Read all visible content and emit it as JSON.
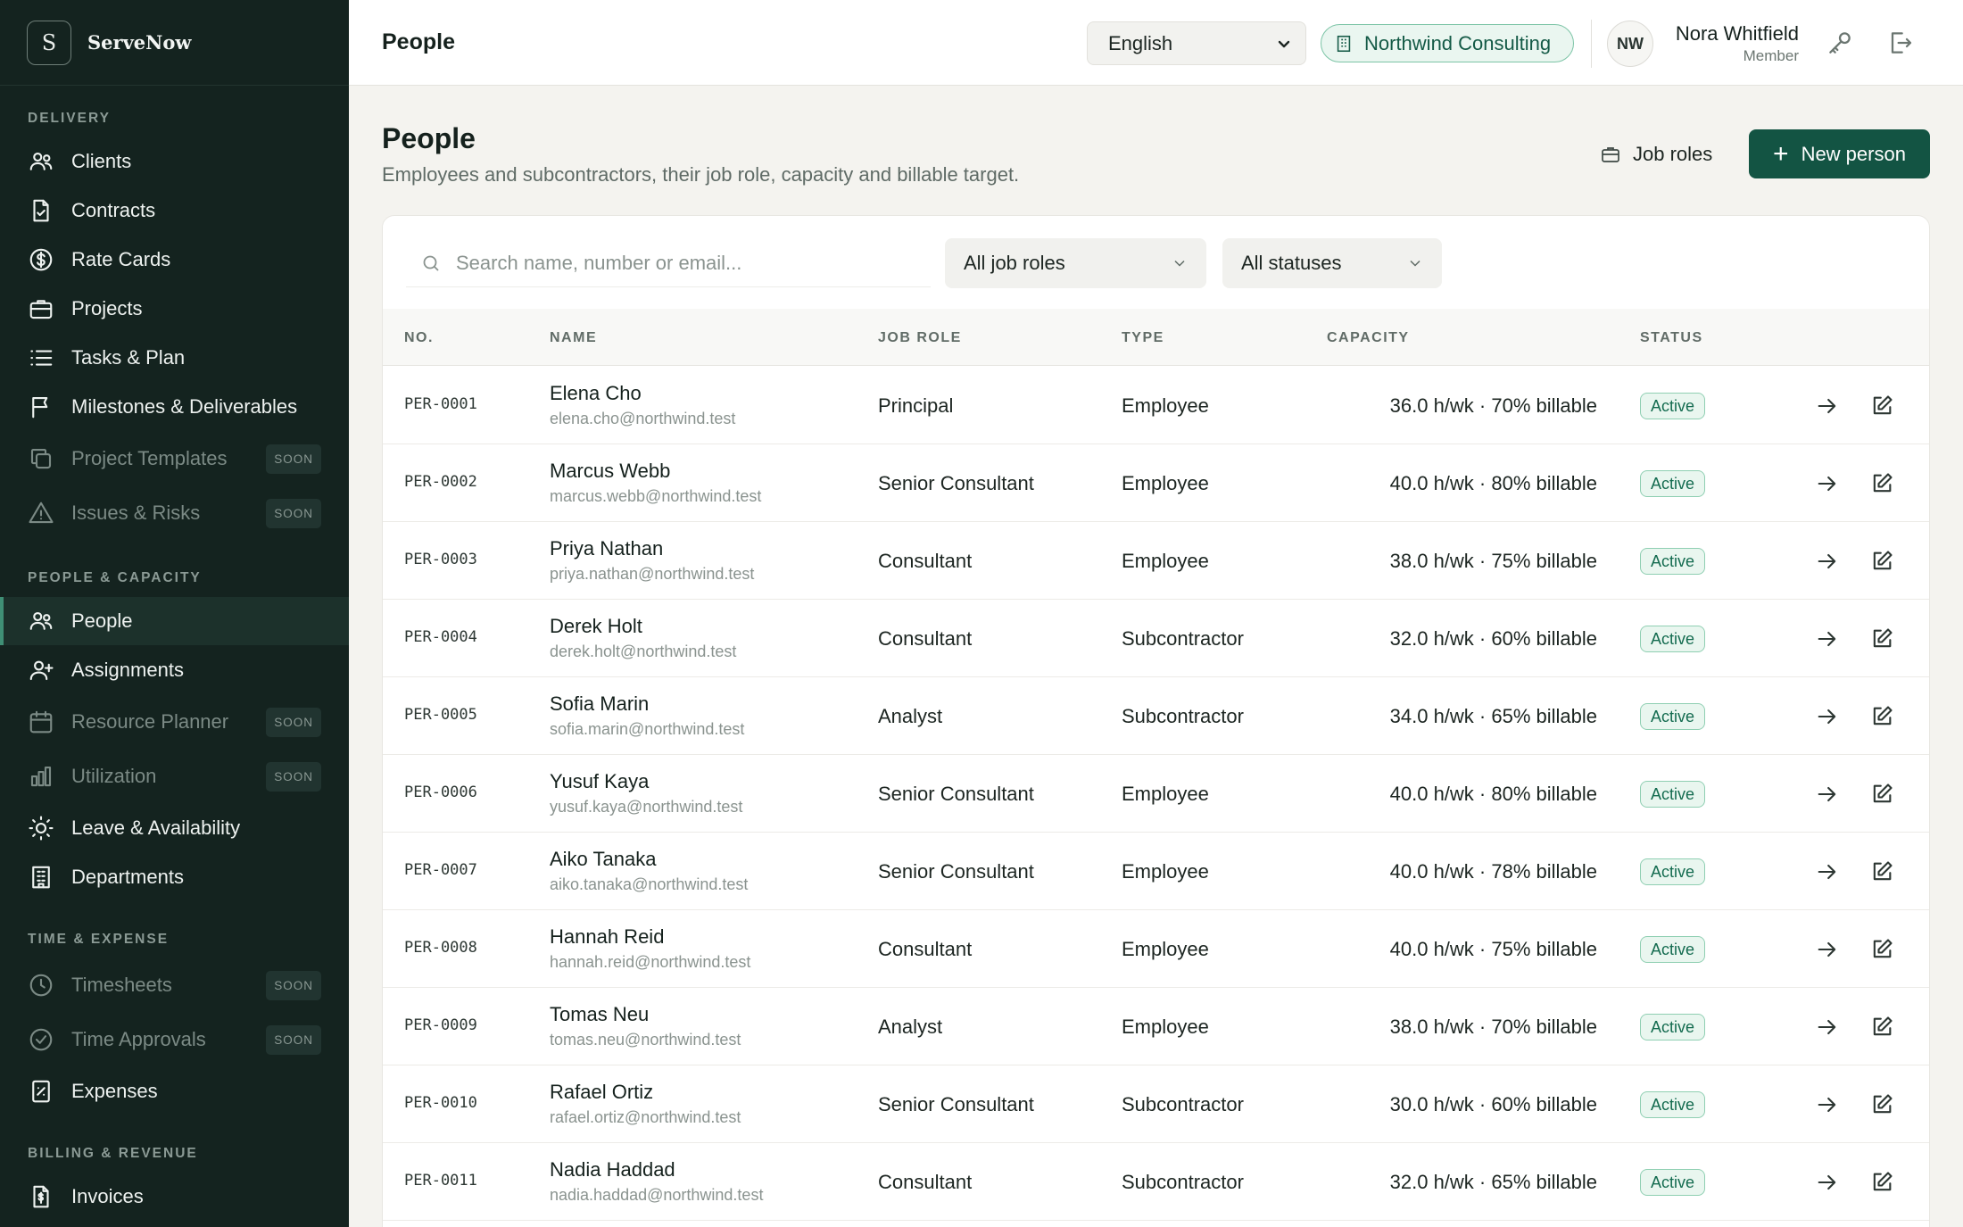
{
  "brand": {
    "logo_letter": "S",
    "name": "ServeNow"
  },
  "sidebar": {
    "sections": [
      {
        "label": "DELIVERY"
      },
      {
        "label": "PEOPLE & CAPACITY"
      },
      {
        "label": "TIME & EXPENSE"
      },
      {
        "label": "BILLING & REVENUE"
      }
    ],
    "items": [
      {
        "label": "Clients",
        "icon": "users-icon"
      },
      {
        "label": "Contracts",
        "icon": "file-check-icon"
      },
      {
        "label": "Rate Cards",
        "icon": "dollar-circle-icon"
      },
      {
        "label": "Projects",
        "icon": "briefcase-icon"
      },
      {
        "label": "Tasks & Plan",
        "icon": "list-icon"
      },
      {
        "label": "Milestones & Deliverables",
        "icon": "flag-icon"
      },
      {
        "label": "Project Templates",
        "icon": "copy-icon",
        "badge": "SOON"
      },
      {
        "label": "Issues & Risks",
        "icon": "warning-icon",
        "badge": "SOON"
      },
      {
        "label": "People",
        "icon": "users-icon"
      },
      {
        "label": "Assignments",
        "icon": "user-plus-icon"
      },
      {
        "label": "Resource Planner",
        "icon": "calendar-icon",
        "badge": "SOON"
      },
      {
        "label": "Utilization",
        "icon": "bar-chart-icon",
        "badge": "SOON"
      },
      {
        "label": "Leave & Availability",
        "icon": "sun-icon"
      },
      {
        "label": "Departments",
        "icon": "building-icon"
      },
      {
        "label": "Timesheets",
        "icon": "clock-icon",
        "badge": "SOON"
      },
      {
        "label": "Time Approvals",
        "icon": "check-circle-icon",
        "badge": "SOON"
      },
      {
        "label": "Expenses",
        "icon": "receipt-icon"
      },
      {
        "label": "Invoices",
        "icon": "invoice-icon"
      }
    ]
  },
  "topbar": {
    "title": "People",
    "language": "English",
    "organization": "Northwind Consulting",
    "user_initials": "NW",
    "user_name": "Nora Whitfield",
    "user_role": "Member"
  },
  "page": {
    "title": "People",
    "subtitle": "Employees and subcontractors, their job role, capacity and billable target.",
    "job_roles_button": "Job roles",
    "new_button": "New person"
  },
  "filters": {
    "search_placeholder": "Search name, number or email...",
    "job_role": "All job roles",
    "status": "All statuses"
  },
  "table": {
    "headers": {
      "no": "NO.",
      "name": "NAME",
      "job_role": "JOB ROLE",
      "type": "TYPE",
      "capacity": "CAPACITY",
      "status": "STATUS"
    },
    "rows": [
      {
        "no": "PER-0001",
        "name": "Elena Cho",
        "email": "elena.cho@northwind.test",
        "role": "Principal",
        "type": "Employee",
        "capacity": "36.0 h/wk · 70% billable",
        "status": "Active"
      },
      {
        "no": "PER-0002",
        "name": "Marcus Webb",
        "email": "marcus.webb@northwind.test",
        "role": "Senior Consultant",
        "type": "Employee",
        "capacity": "40.0 h/wk · 80% billable",
        "status": "Active"
      },
      {
        "no": "PER-0003",
        "name": "Priya Nathan",
        "email": "priya.nathan@northwind.test",
        "role": "Consultant",
        "type": "Employee",
        "capacity": "38.0 h/wk · 75% billable",
        "status": "Active"
      },
      {
        "no": "PER-0004",
        "name": "Derek Holt",
        "email": "derek.holt@northwind.test",
        "role": "Consultant",
        "type": "Subcontractor",
        "capacity": "32.0 h/wk · 60% billable",
        "status": "Active"
      },
      {
        "no": "PER-0005",
        "name": "Sofia Marin",
        "email": "sofia.marin@northwind.test",
        "role": "Analyst",
        "type": "Subcontractor",
        "capacity": "34.0 h/wk · 65% billable",
        "status": "Active"
      },
      {
        "no": "PER-0006",
        "name": "Yusuf Kaya",
        "email": "yusuf.kaya@northwind.test",
        "role": "Senior Consultant",
        "type": "Employee",
        "capacity": "40.0 h/wk · 80% billable",
        "status": "Active"
      },
      {
        "no": "PER-0007",
        "name": "Aiko Tanaka",
        "email": "aiko.tanaka@northwind.test",
        "role": "Senior Consultant",
        "type": "Employee",
        "capacity": "40.0 h/wk · 78% billable",
        "status": "Active"
      },
      {
        "no": "PER-0008",
        "name": "Hannah Reid",
        "email": "hannah.reid@northwind.test",
        "role": "Consultant",
        "type": "Employee",
        "capacity": "40.0 h/wk · 75% billable",
        "status": "Active"
      },
      {
        "no": "PER-0009",
        "name": "Tomas Neu",
        "email": "tomas.neu@northwind.test",
        "role": "Analyst",
        "type": "Employee",
        "capacity": "38.0 h/wk · 70% billable",
        "status": "Active"
      },
      {
        "no": "PER-0010",
        "name": "Rafael Ortiz",
        "email": "rafael.ortiz@northwind.test",
        "role": "Senior Consultant",
        "type": "Subcontractor",
        "capacity": "30.0 h/wk · 60% billable",
        "status": "Active"
      },
      {
        "no": "PER-0011",
        "name": "Nadia Haddad",
        "email": "nadia.haddad@northwind.test",
        "role": "Consultant",
        "type": "Subcontractor",
        "capacity": "32.0 h/wk · 65% billable",
        "status": "Active"
      }
    ]
  },
  "colors": {
    "sidebar_bg": "#14231f",
    "accent": "#135443",
    "active_badge": "#136b4f"
  }
}
